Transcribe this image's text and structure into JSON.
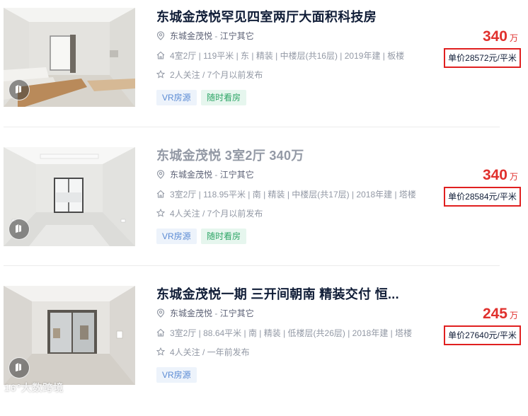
{
  "listings": [
    {
      "title": "东城金茂悦罕见四室两厅大面积科技房",
      "visited": false,
      "community": "东城金茂悦",
      "separator": " - ",
      "district": "江宁其它",
      "specs": "4室2厅 | 119平米 | 东 | 精装 | 中楼层(共16层) | 2019年建 | 板楼",
      "follow": "2人关注 / 7个月以前发布",
      "tags": [
        "VR房源",
        "随时看房"
      ],
      "total_price": "340",
      "price_unit": "万",
      "unit_price": "单价28572元/平米",
      "photo": "living-room-sofa"
    },
    {
      "title": "东城金茂悦 3室2厅 340万",
      "visited": true,
      "community": "东城金茂悦",
      "separator": " - ",
      "district": "江宁其它",
      "specs": "3室2厅 | 118.95平米 | 南 | 精装 | 中楼层(共17层) | 2018年建 | 塔楼",
      "follow": "4人关注 / 7个月以前发布",
      "tags": [
        "VR房源",
        "随时看房"
      ],
      "total_price": "340",
      "price_unit": "万",
      "unit_price": "单价28584元/平米",
      "photo": "empty-room-balcony"
    },
    {
      "title": "东城金茂悦一期 三开间朝南 精装交付 恒...",
      "visited": false,
      "community": "东城金茂悦",
      "separator": " - ",
      "district": "江宁其它",
      "specs": "3室2厅 | 88.64平米 | 南 | 精装 | 低楼层(共26层) | 2018年建 | 塔楼",
      "follow": "4人关注 / 一年前发布",
      "tags": [
        "VR房源"
      ],
      "total_price": "245",
      "price_unit": "万",
      "unit_price": "单价27640元/平米",
      "photo": "empty-room-sliding-door"
    }
  ],
  "icons": {
    "location": "location-pin-icon",
    "house": "house-icon",
    "star": "star-icon",
    "vr": "vr-badge-icon"
  },
  "colors": {
    "title": "#101d37",
    "title_visited": "#9399a5",
    "price": "#e0302d",
    "highlight_box": "#e02020",
    "tag_vr": "#5b8bd4",
    "tag_see": "#2fa667"
  },
  "watermark": "16°大数跨境"
}
